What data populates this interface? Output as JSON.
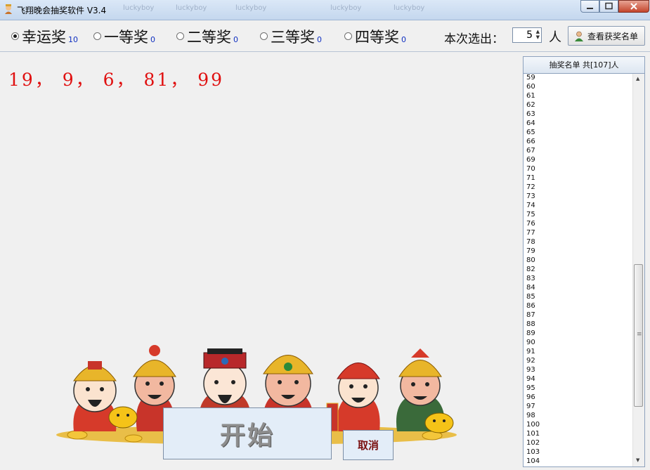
{
  "window": {
    "title": "飞翔晚会抽奖软件 V3.4",
    "ghost_tabs": [
      "luckyboy",
      "luckyboy",
      "luckyboy",
      "luckyboy",
      "luckyboy"
    ]
  },
  "toolbar": {
    "prizes": [
      {
        "label": "幸运奖",
        "count": "10",
        "checked": true
      },
      {
        "label": "一等奖",
        "count": "0",
        "checked": false
      },
      {
        "label": "二等奖",
        "count": "0",
        "checked": false
      },
      {
        "label": "三等奖",
        "count": "0",
        "checked": false
      },
      {
        "label": "四等奖",
        "count": "0",
        "checked": false
      }
    ],
    "select_label": "本次选出：",
    "select_value": "5",
    "person_label": "人",
    "winners_button": "查看获奖名单"
  },
  "result": {
    "text": "19， 9， 6， 81， 99"
  },
  "buttons": {
    "start": "开始",
    "cancel": "取消"
  },
  "list_panel": {
    "header": "抽奖名单 共[107]人",
    "items": [
      "59",
      "60",
      "61",
      "62",
      "63",
      "64",
      "65",
      "66",
      "67",
      "69",
      "70",
      "71",
      "72",
      "73",
      "74",
      "75",
      "76",
      "77",
      "78",
      "79",
      "80",
      "82",
      "83",
      "84",
      "85",
      "86",
      "87",
      "88",
      "89",
      "90",
      "91",
      "92",
      "93",
      "94",
      "95",
      "96",
      "97",
      "98",
      "100",
      "101",
      "102",
      "103",
      "104"
    ]
  },
  "colors": {
    "result_red": "#e01010",
    "count_blue": "#1030c0",
    "cancel_text": "#7a1010"
  }
}
